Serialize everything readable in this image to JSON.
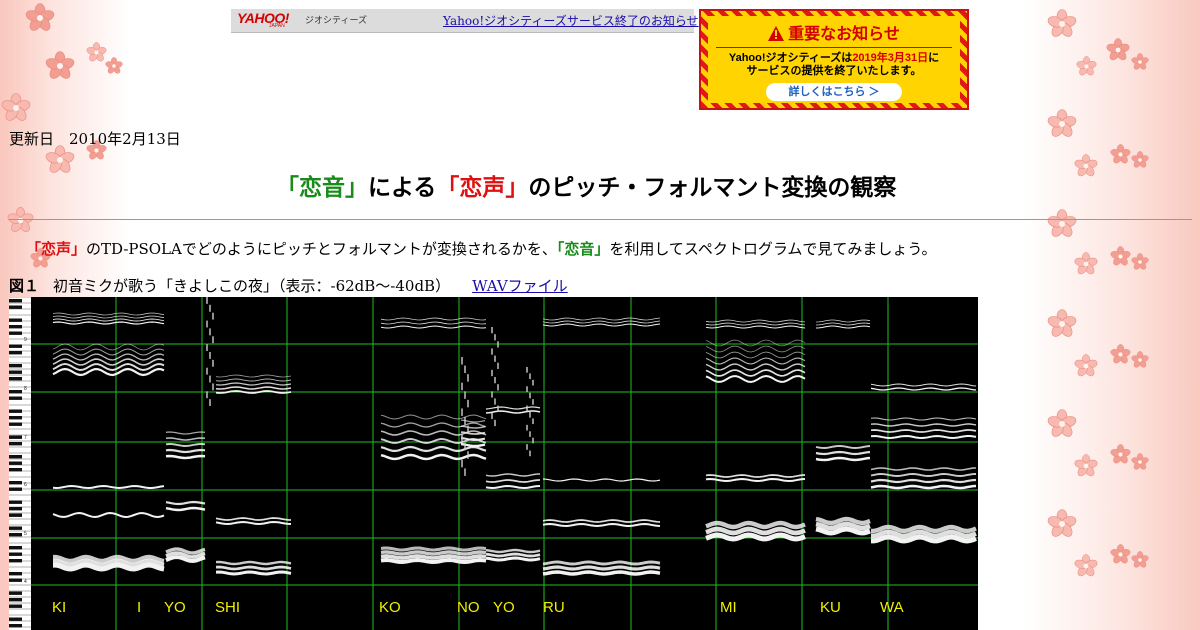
{
  "yahoo_banner": {
    "logo": "YAHOO!",
    "logo_sub": "JAPAN",
    "service": "ジオシティーズ",
    "link_text": "Yahoo!ジオシティーズサービス終了のお知らせ"
  },
  "notice": {
    "title": "重要なお知らせ",
    "body_prefix": "Yahoo!ジオシティーズは",
    "body_date": "2019年3月31日",
    "body_suffix": "に",
    "body_line2": "サービスの提供を終了いたします。",
    "button": "詳しくはこちら ＞",
    "colors": {
      "accent": "#d40000",
      "background": "#ffd400"
    }
  },
  "updated": "更新日　2010年2月13日",
  "title": {
    "q1_open": "「",
    "q1_word": "恋音",
    "q1_close": "」",
    "mid": "による",
    "q2_open": "「",
    "q2_word": "恋声",
    "q2_close": "」",
    "rest": "のピッチ・フォルマント変換の観察"
  },
  "intro": {
    "koigoe": "「恋声」",
    "part1": "のTD-PSOLAでどのようにピッチとフォルマントが変換されるかを、",
    "koion": "「恋音」",
    "part2": "を利用してスペクトログラムで見てみましょう。"
  },
  "figure": {
    "label": "図１",
    "caption": "初音ミクが歌う「きよしこの夜」（表示：-62dB～-40dB）",
    "wav_link": "WAVファイル"
  },
  "spectrogram": {
    "syllables": [
      "KI",
      "I",
      "YO",
      "SHI",
      "KO",
      "NO",
      "YO",
      "RU",
      "MI",
      "KU",
      "WA"
    ],
    "piano_octaves": [
      "9",
      "8",
      "7",
      "6",
      "5",
      "4"
    ],
    "colors": {
      "grid": "#1fbf1f",
      "label": "#f0f000"
    }
  }
}
